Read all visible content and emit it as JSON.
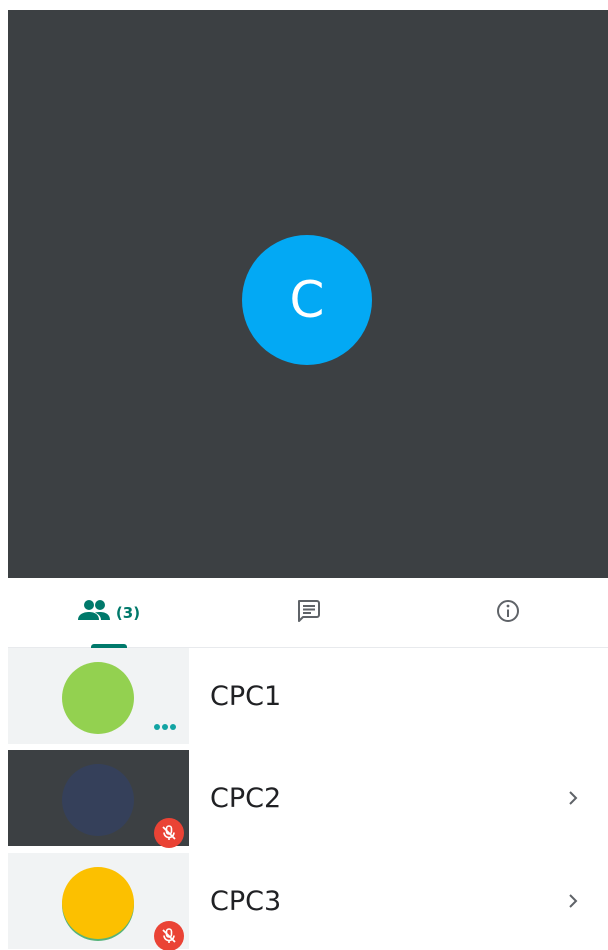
{
  "main_video": {
    "avatar_initial": "C",
    "avatar_color": "#03a9f4"
  },
  "tabs": [
    {
      "icon": "people-icon",
      "count_label": "(3)",
      "selected": true
    },
    {
      "icon": "chat-icon",
      "selected": false
    },
    {
      "icon": "info-icon",
      "selected": false
    }
  ],
  "participants": [
    {
      "name": "CPC1",
      "avatar_color": "#93d150",
      "status": "more-options",
      "has_chevron": false
    },
    {
      "name": "CPC2",
      "avatar_color": "#35405a",
      "status": "muted",
      "has_chevron": true
    },
    {
      "name": "CPC3",
      "avatar_color": "#fcc000",
      "status": "muted",
      "has_chevron": true
    }
  ],
  "colors": {
    "accent": "#00796b",
    "video_background": "#3c4043",
    "muted_badge": "#ea4335"
  }
}
